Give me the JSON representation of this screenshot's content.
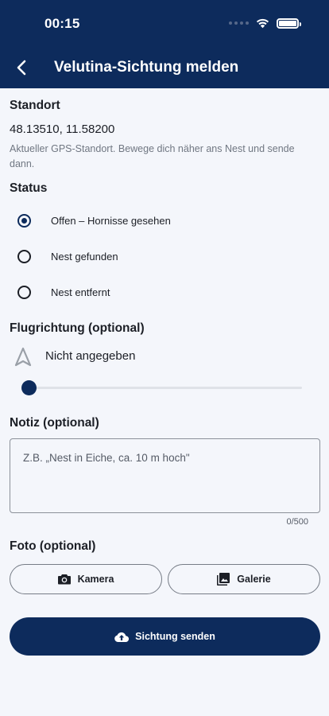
{
  "status_bar": {
    "time": "00:15"
  },
  "header": {
    "title": "Velutina-Sichtung melden",
    "back_icon": "chevron-left-icon"
  },
  "location": {
    "label": "Standort",
    "coordinates": "48.13510, 11.58200",
    "hint": "Aktueller GPS-Standort. Bewege dich näher ans Nest und sende dann."
  },
  "status": {
    "label": "Status",
    "selected": 0,
    "options": [
      {
        "label": "Offen – Hornisse gesehen"
      },
      {
        "label": "Nest gefunden"
      },
      {
        "label": "Nest entfernt"
      }
    ]
  },
  "direction": {
    "label": "Flugrichtung (optional)",
    "value_label": "Nicht angegeben",
    "icon": "navigation-arrow-icon",
    "slider_fraction": 0
  },
  "note": {
    "label": "Notiz (optional)",
    "placeholder": "Z.B. „Nest in Eiche, ca. 10 m hoch\"",
    "counter": "0/500"
  },
  "photo": {
    "label": "Foto (optional)",
    "camera_label": "Kamera",
    "gallery_label": "Galerie"
  },
  "submit": {
    "label": "Sichtung senden",
    "icon": "cloud-upload-icon"
  },
  "colors": {
    "primary": "#0d2b5c",
    "background": "#f4f6fb",
    "muted_text": "#707782"
  }
}
